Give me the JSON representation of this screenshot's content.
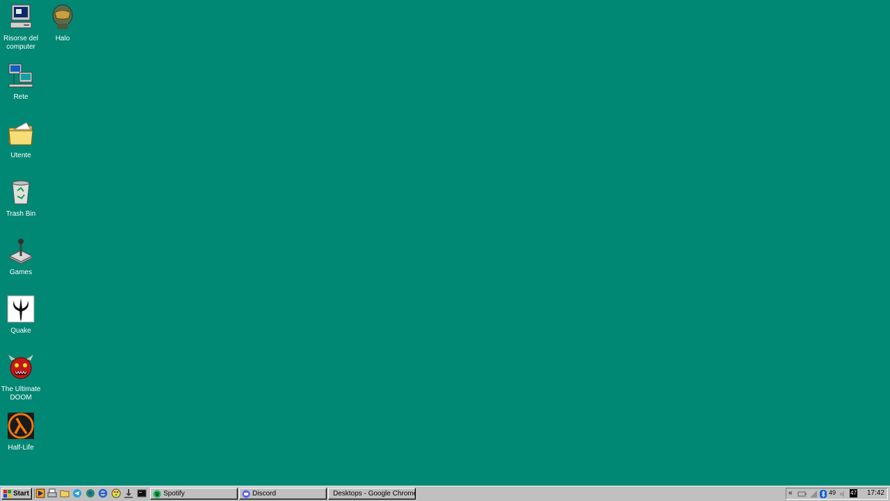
{
  "desktop": {
    "background": "#008875",
    "icons": [
      {
        "label": "Risorse del computer",
        "icon": "my-computer-icon"
      },
      {
        "label": "Halo",
        "icon": "halo-helmet-icon"
      },
      {
        "label": "Rete",
        "icon": "network-icon"
      },
      {
        "label": "Utente",
        "icon": "user-folder-icon"
      },
      {
        "label": "Trash Bin",
        "icon": "recycle-bin-icon"
      },
      {
        "label": "Games",
        "icon": "joystick-icon"
      },
      {
        "label": "Quake",
        "icon": "quake-icon"
      },
      {
        "label": "The Ultimate DOOM",
        "icon": "doom-icon"
      },
      {
        "label": "Half-Life",
        "icon": "half-life-icon"
      }
    ]
  },
  "taskbar": {
    "start_label": "Start",
    "quick_launch": [
      "media-player-icon",
      "printer-icon",
      "folder-icon",
      "telegram-icon",
      "edge-icon",
      "internet-explorer-icon",
      "paint-icon",
      "download-icon",
      "terminal-icon"
    ],
    "tasks": [
      {
        "label": "Spotify",
        "icon": "spotify-icon"
      },
      {
        "label": "Discord",
        "icon": "discord-icon"
      },
      {
        "label": "Desktops - Google Chrome",
        "icon": "chrome-icon"
      }
    ],
    "tray": {
      "expand_symbol": "«",
      "badge_49": "49",
      "badge_47": "47",
      "clock": "17:42"
    }
  }
}
